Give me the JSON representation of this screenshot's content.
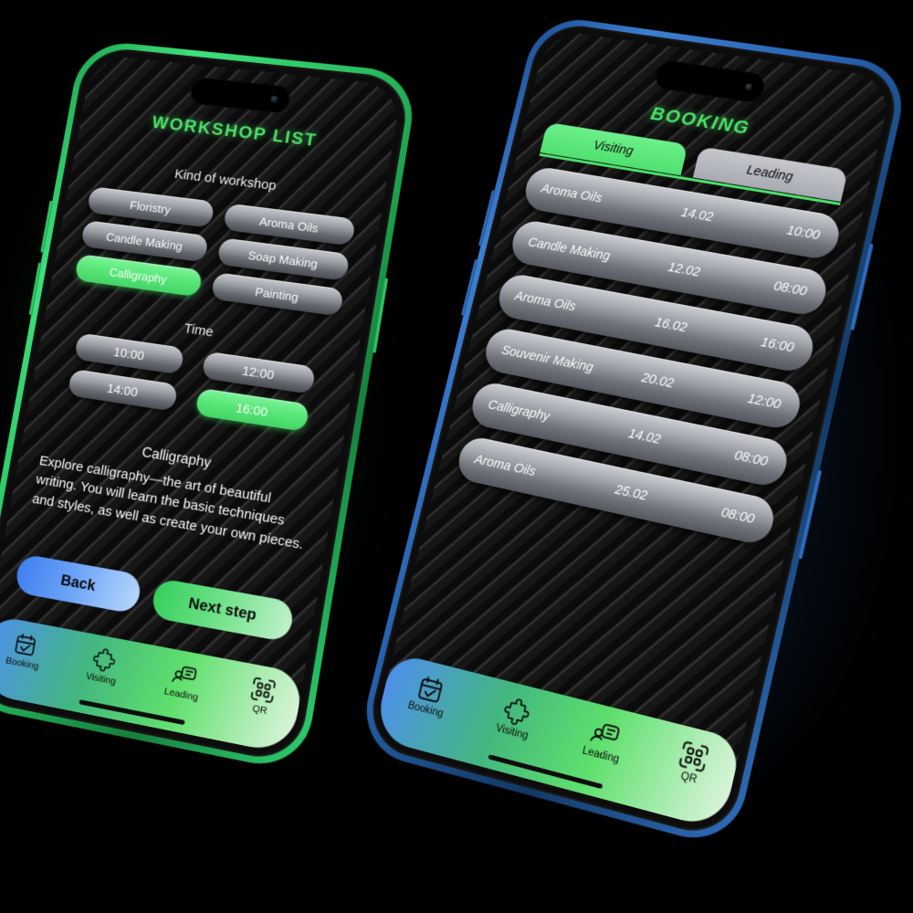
{
  "left_phone": {
    "frame_color": "#2fcd6d",
    "accent_color": "#4ae46a",
    "screen": {
      "title": "WORKSHOP LIST",
      "kind_label": "Kind of workshop",
      "workshop_chips": [
        {
          "label": "Floristry",
          "selected": false
        },
        {
          "label": "Aroma Oils",
          "selected": false
        },
        {
          "label": "Candle Making",
          "selected": false
        },
        {
          "label": "Soap Making",
          "selected": false
        },
        {
          "label": "Calligraphy",
          "selected": true
        },
        {
          "label": "Painting",
          "selected": false
        }
      ],
      "time_label": "Time",
      "time_chips": [
        {
          "label": "10:00",
          "selected": false
        },
        {
          "label": "12:00",
          "selected": false
        },
        {
          "label": "14:00",
          "selected": false
        },
        {
          "label": "16:00",
          "selected": true
        }
      ],
      "description": {
        "title": "Calligraphy",
        "body": "Explore calligraphy—the art of beautiful writing. You will learn the basic techniques and styles, as well as create your own pieces."
      },
      "buttons": {
        "back": "Back",
        "next": "Next step"
      }
    }
  },
  "right_phone": {
    "frame_color": "#2a62ad",
    "accent_color": "#4ae46a",
    "screen": {
      "title": "BOOKING",
      "tabs": [
        {
          "label": "Visiting",
          "active": true
        },
        {
          "label": "Leading",
          "active": false
        }
      ],
      "bookings": [
        {
          "name": "Aroma Oils",
          "date": "14.02",
          "time": "10:00"
        },
        {
          "name": "Candle Making",
          "date": "12.02",
          "time": "08:00"
        },
        {
          "name": "Aroma Oils",
          "date": "16.02",
          "time": "16:00"
        },
        {
          "name": "Souvenir Making",
          "date": "20.02",
          "time": "12:00"
        },
        {
          "name": "Calligraphy",
          "date": "14.02",
          "time": "08:00"
        },
        {
          "name": "Aroma Oils",
          "date": "25.02",
          "time": "08:00"
        }
      ]
    }
  },
  "navbar": {
    "items": [
      {
        "label": "Booking",
        "icon": "calendar-check-icon"
      },
      {
        "label": "Visiting",
        "icon": "puzzle-piece-icon"
      },
      {
        "label": "Leading",
        "icon": "chat-message-icon"
      },
      {
        "label": "QR",
        "icon": "qr-code-icon"
      }
    ]
  }
}
